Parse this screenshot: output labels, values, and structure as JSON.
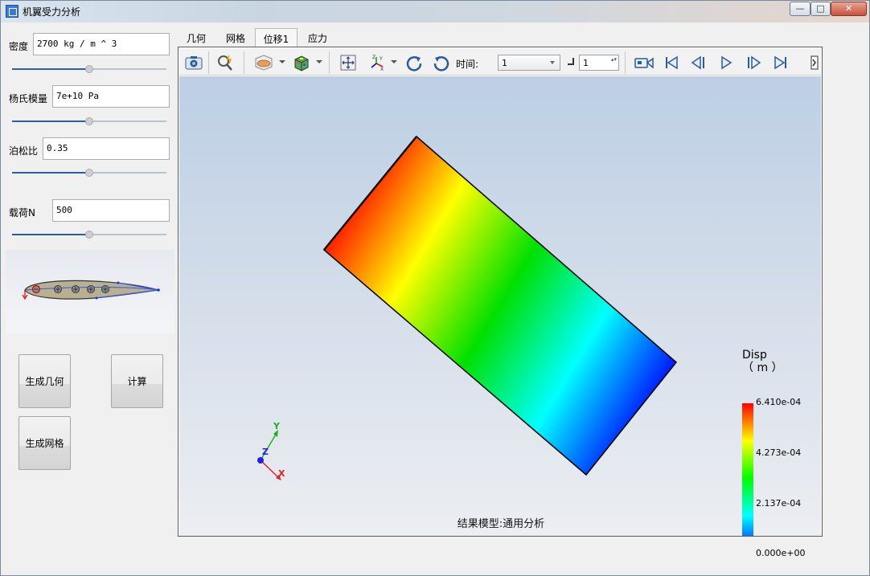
{
  "window": {
    "title": "机翼受力分析",
    "buttons": {
      "minimize": "—",
      "maximize": "□",
      "close": "✕"
    }
  },
  "params": {
    "density": {
      "label": "密度",
      "value": "2700 kg / m ^ 3",
      "slider_fraction": 0.5
    },
    "youngs": {
      "label": "杨氏模量",
      "value": "7e+10 Pa",
      "slider_fraction": 0.5
    },
    "poisson": {
      "label": "泊松比",
      "value": "0.35",
      "slider_fraction": 0.5
    },
    "load": {
      "label": "载荷N",
      "value": "500",
      "slider_fraction": 0.5
    }
  },
  "actions": {
    "gen_geometry": "生成几何",
    "compute": "计算",
    "gen_mesh": "生成网格"
  },
  "tabs": [
    "几何",
    "网格",
    "位移1",
    "应力"
  ],
  "active_tab": "位移1",
  "toolbar": {
    "time_label": "时间:",
    "time_value": "1",
    "step_value": "1",
    "icons": [
      "camera-icon",
      "query-icon",
      "display-mode-icon",
      "color-cube-icon",
      "fit-view-icon",
      "axes-orient-icon",
      "rotate-cw-icon",
      "rotate-ccw-icon",
      "record-icon",
      "first-frame-icon",
      "prev-frame-icon",
      "play-icon",
      "next-frame-icon",
      "last-frame-icon"
    ]
  },
  "viewport": {
    "caption": "结果模型:通用分析",
    "axis_labels": {
      "x": "X",
      "y": "Y",
      "z": "Z"
    }
  },
  "legend": {
    "title": "Disp",
    "unit": "（ m ）",
    "values": [
      "6.410e-04",
      "4.273e-04",
      "2.137e-04",
      "0.000e+00"
    ]
  },
  "colors": {
    "legend_gradient": [
      "#ff0000",
      "#ffff00",
      "#00ff00",
      "#00ffff",
      "#0000ff"
    ],
    "accent": "#2a5fa8"
  }
}
